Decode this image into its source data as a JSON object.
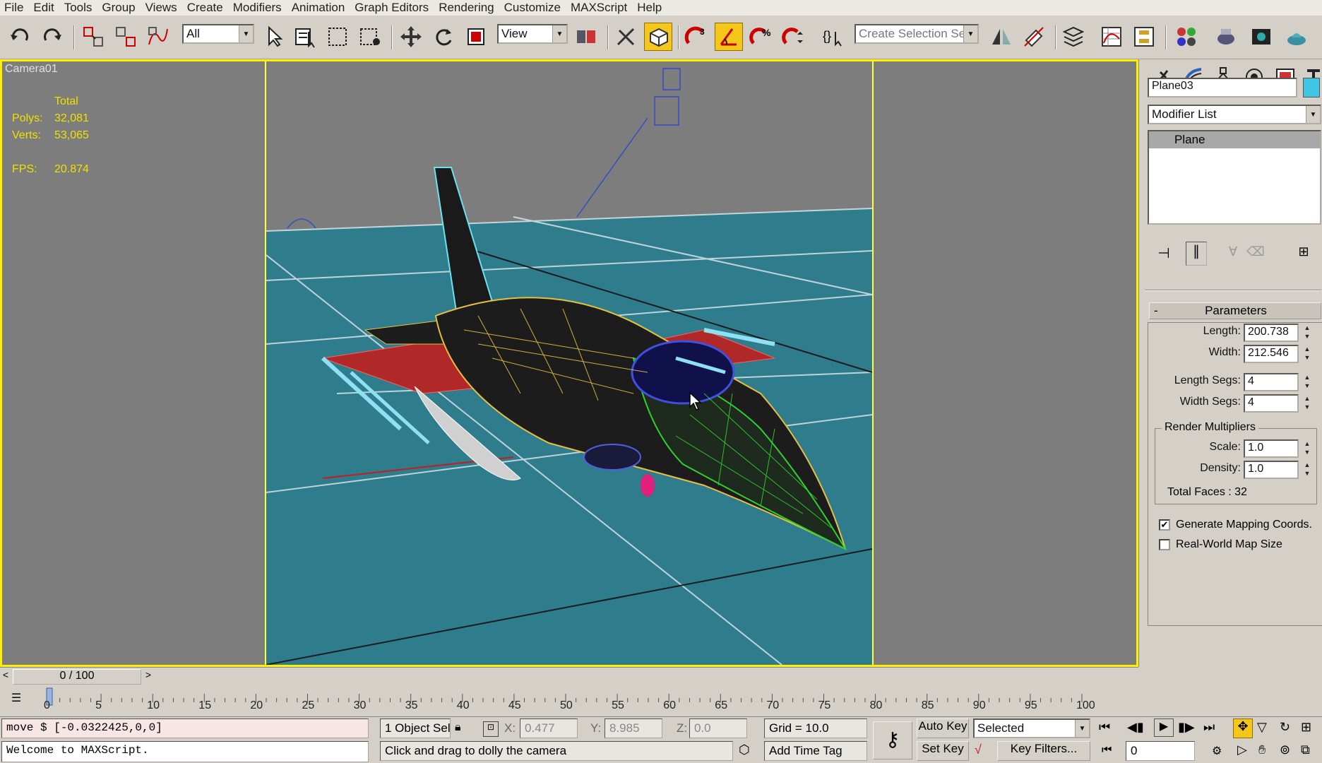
{
  "menu": [
    "File",
    "Edit",
    "Tools",
    "Group",
    "Views",
    "Create",
    "Modifiers",
    "Animation",
    "Graph Editors",
    "Rendering",
    "Customize",
    "MAXScript",
    "Help"
  ],
  "toolbar": {
    "filter_value": "All",
    "coord_value": "View",
    "selection_set_placeholder": "Create Selection Set",
    "icons": [
      "undo-icon",
      "redo-icon",
      "select-link-icon",
      "unlink-icon",
      "bind-spacewarp-icon",
      "select-object-icon",
      "select-by-name-icon",
      "rect-selection-icon",
      "window-crossing-icon",
      "move-icon",
      "rotate-icon",
      "scale-icon",
      "use-pivot-icon",
      "select-manipulate-icon",
      "keyboard-shortcut-icon",
      "snap-3d-icon",
      "angle-snap-icon",
      "percent-snap-icon",
      "spinner-snap-icon",
      "named-selection-icon",
      "mirror-icon",
      "align-icon",
      "layer-manager-icon",
      "curve-editor-icon",
      "schematic-view-icon",
      "material-editor-icon",
      "render-setup-icon",
      "rendered-frame-icon",
      "quick-render-icon"
    ]
  },
  "viewport": {
    "label": "Camera01",
    "stats_header": "Total",
    "polys_label": "Polys:",
    "polys_value": "32,081",
    "verts_label": "Verts:",
    "verts_value": "53,065",
    "fps_label": "FPS:",
    "fps_value": "20.874"
  },
  "command_panel": {
    "object_name": "Plane03",
    "object_color": "#3fc6e6",
    "modifier_list": "Modifier List",
    "stack_item": "Plane",
    "rollout_title": "Parameters",
    "rollout_toggle": "-",
    "length_label": "Length:",
    "length_value": "200.738",
    "width_label": "Width:",
    "width_value": "212.546",
    "length_segs_label": "Length Segs:",
    "length_segs_value": "4",
    "width_segs_label": "Width Segs:",
    "width_segs_value": "4",
    "render_mult_label": "Render Multipliers",
    "scale_label": "Scale:",
    "scale_value": "1.0",
    "density_label": "Density:",
    "density_value": "1.0",
    "total_faces": "Total Faces : 32",
    "gen_mapping_label": "Generate Mapping Coords.",
    "gen_mapping_checked": true,
    "real_world_label": "Real-World Map Size",
    "real_world_checked": false
  },
  "timeline": {
    "frame_display": "0 / 100",
    "prev": "<",
    "next": ">",
    "ticks": [
      "0",
      "5",
      "10",
      "15",
      "20",
      "25",
      "30",
      "35",
      "40",
      "45",
      "50",
      "55",
      "60",
      "65",
      "70",
      "75",
      "80",
      "85",
      "90",
      "95",
      "100"
    ]
  },
  "status": {
    "maxscript_line": "move $ [-0.0322425,0,0]",
    "maxscript_listener": "Welcome to MAXScript.",
    "selection_count": "1 Object Sel",
    "x_label": "X:",
    "x_value": "0.477",
    "y_label": "Y:",
    "y_value": "8.985",
    "z_label": "Z:",
    "z_value": "0.0",
    "grid": "Grid = 10.0",
    "prompt": "Click and drag to dolly the camera",
    "add_time_tag": "Add Time Tag",
    "auto_key": "Auto Key",
    "set_key": "Set Key",
    "key_mode": "Selected",
    "key_filters": "Key Filters...",
    "current_frame": "0"
  }
}
